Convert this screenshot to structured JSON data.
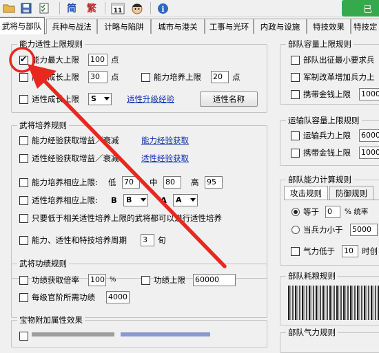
{
  "toolbar": {
    "simplified": "简",
    "traditional": "繁",
    "calendar_num": "11",
    "info": "i",
    "green_button": "已"
  },
  "tabs": [
    "武将与部队",
    "兵种与战法",
    "计略与陷阱",
    "城市与港关",
    "工事与光环",
    "内政与设施",
    "特技效果",
    "特技定"
  ],
  "ability": {
    "legend": "能力适性上限规则",
    "max_label": "能力最大上限",
    "max_value": "100",
    "max_unit": "点",
    "growth_label": "能力成长上限",
    "growth_value": "30",
    "growth_unit": "点",
    "train_label": "能力培养上限",
    "train_value": "20",
    "train_unit": "点",
    "apt_label": "适性成长上限",
    "apt_value": "S",
    "apt_link": "适性升级经验",
    "apt_name_btn": "适性名称"
  },
  "training": {
    "legend": "武将培养规则",
    "exp_gain": "能力经验获取增益／衰减",
    "exp_link": "能力经验获取",
    "apt_exp_gain": "适性经验获取增益／衰减",
    "apt_exp_link": "适性经验获取",
    "ability_limit": "能力培养相应上限:",
    "low": "低",
    "low_value": "70",
    "mid": "中",
    "mid_value": "80",
    "high": "高",
    "high_value": "95",
    "apt_limit": "适性培养相应上限:",
    "apt_b": "B",
    "apt_b_value": "B",
    "apt_a": "A",
    "apt_a_value": "A",
    "only_lower": "只要低于相关适性培养上限的武将都可以进行适性培养",
    "period_label": "能力、适性和特技培养周期",
    "period_value": "3",
    "period_unit": "旬"
  },
  "merit": {
    "legend": "武将功绩规则",
    "rate_label": "功绩获取倍率",
    "rate_value": "100",
    "rate_unit": "%",
    "cap_label": "功绩上限",
    "cap_value": "60000",
    "rank_label": "每级官阶所需功绩",
    "rank_value": "4000"
  },
  "treasure": {
    "legend": "宝物附加属性效果"
  },
  "unit_cap": {
    "legend": "部队容量上限规则",
    "row1": "部队出征最小要求兵",
    "row2": "军制改革增加兵力上",
    "row3": "携带金钱上限",
    "row3_value": "1000"
  },
  "transport": {
    "legend": "运输队容量上限规则",
    "row1": "运输兵力上限",
    "row1_value": "6000",
    "row2": "携带金钱上限",
    "row2_value": "1000"
  },
  "calc": {
    "legend": "部队能力计算规则",
    "tab_attack": "攻击规则",
    "tab_defense": "防御规则",
    "equal_label": "等于",
    "equal_value": "0",
    "equal_suffix": "% 统率",
    "less_label": "当兵力小于",
    "less_value": "5000",
    "morale_label": "气力低于",
    "morale_value": "10",
    "morale_suffix": "时创"
  },
  "consume": {
    "legend": "部队耗粮规则"
  },
  "morale": {
    "legend": "部队气力规则"
  },
  "colors": {
    "annotation_red": "#e8281f",
    "link_blue": "#0a2fa8",
    "green_button": "#35a94b"
  }
}
